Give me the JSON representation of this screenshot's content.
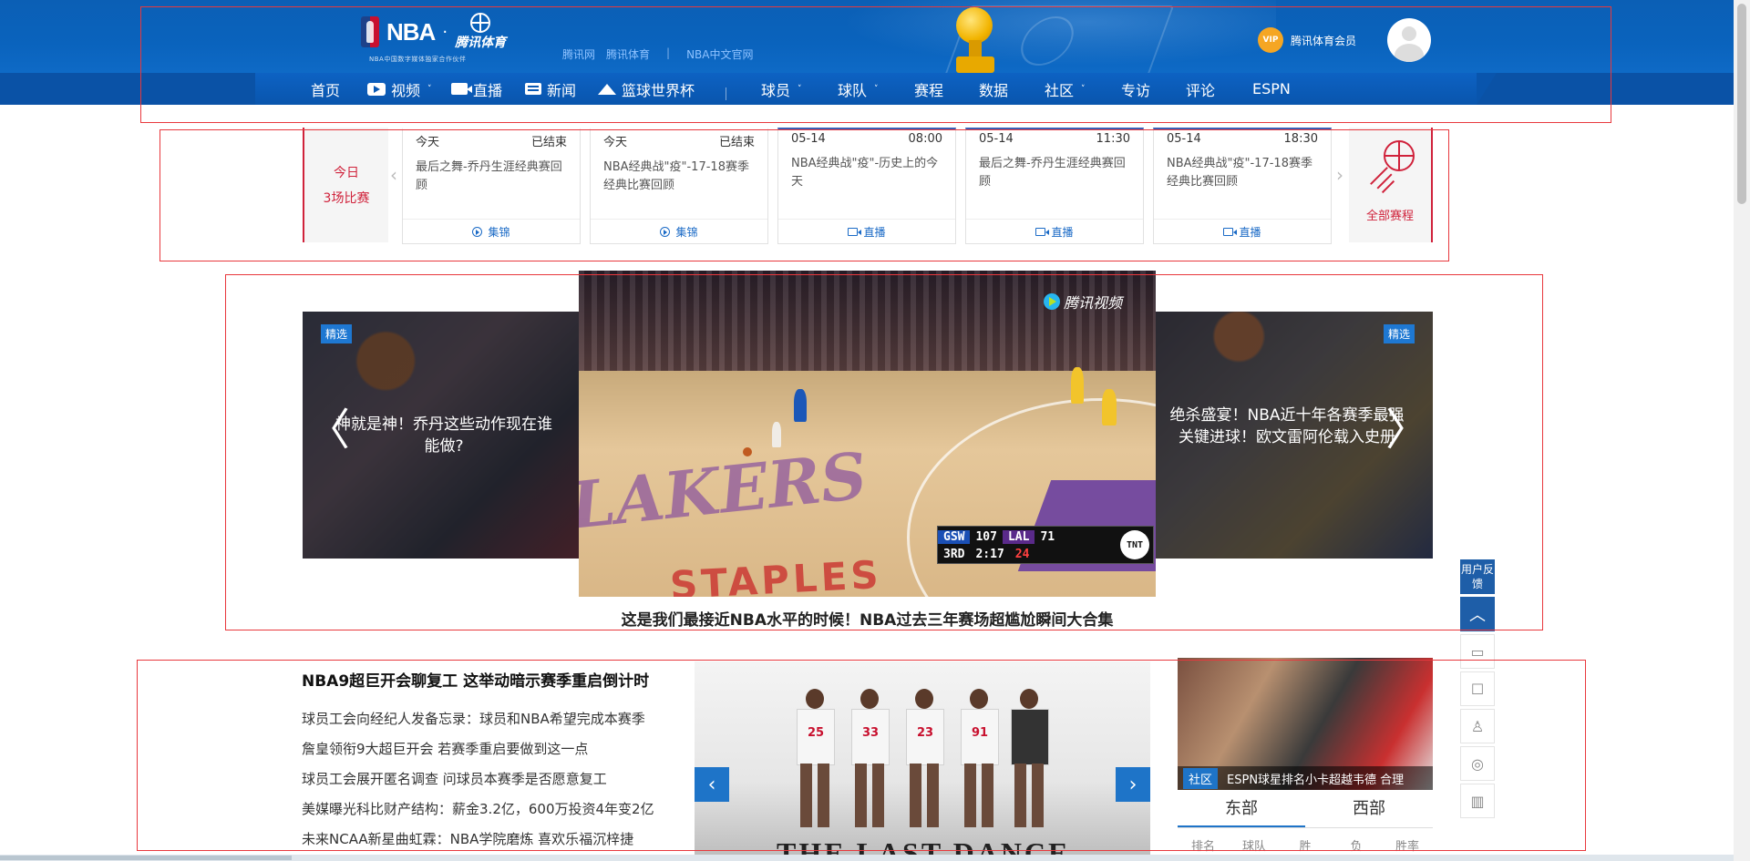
{
  "header": {
    "logo_nba": "NBA",
    "logo_dot": "·",
    "logo_tencent": "腾讯体育",
    "logo_sub": "NBA中国数字媒体独家合作伙伴",
    "top_links": [
      "腾讯网",
      "腾讯体育",
      "|",
      "NBA中文官网"
    ],
    "vip_badge": "VIP",
    "vip_label": "腾讯体育会员"
  },
  "nav": {
    "items": [
      {
        "label": "首页"
      },
      {
        "label": "视频",
        "icon": "video-icon",
        "caret": "˅"
      },
      {
        "label": "直播",
        "icon": "live-camera-icon"
      },
      {
        "label": "新闻",
        "icon": "news-icon"
      },
      {
        "label": "篮球世界杯",
        "icon": "crown-icon"
      },
      {
        "label": "球员",
        "caret": "˅"
      },
      {
        "label": "球队",
        "caret": "˅"
      },
      {
        "label": "赛程"
      },
      {
        "label": "数据"
      },
      {
        "label": "社区",
        "caret": "˅"
      },
      {
        "label": "专访"
      },
      {
        "label": "评论"
      },
      {
        "label": "ESPN"
      }
    ]
  },
  "schedule": {
    "today_label": "今日",
    "count_label": "3场比赛",
    "prev_arrow": "‹",
    "next_arrow": "›",
    "all_label": "全部赛程",
    "cards": [
      {
        "date": "今天",
        "status": "已结束",
        "title": "最后之舞-乔丹生涯经典赛回顾",
        "action": "集锦",
        "kind": "highlight"
      },
      {
        "date": "今天",
        "status": "已结束",
        "title": "NBA经典战\"疫\"-17-18赛季经典比赛回顾",
        "action": "集锦",
        "kind": "highlight"
      },
      {
        "date": "05-14",
        "status": "08:00",
        "title": "NBA经典战\"疫\"-历史上的今天",
        "action": "直播",
        "kind": "live"
      },
      {
        "date": "05-14",
        "status": "11:30",
        "title": "最后之舞-乔丹生涯经典赛回顾",
        "action": "直播",
        "kind": "live"
      },
      {
        "date": "05-14",
        "status": "18:30",
        "title": "NBA经典战\"疫\"-17-18赛季经典比赛回顾",
        "action": "直播",
        "kind": "live"
      }
    ]
  },
  "hero": {
    "left_badge": "精选",
    "left_caption": "神就是神！乔丹这些动作现在谁能做?",
    "right_badge": "精选",
    "right_caption": "绝杀盛宴！NBA近十年各赛季最强关键进球！欧文雷阿伦载入史册",
    "prev_arrow": "〈",
    "next_arrow": "〉",
    "tv_logo": "腾讯视频",
    "scorebug": {
      "team1": "GSW",
      "score1": "107",
      "team2": "LAL",
      "score2": "71",
      "period": "3RD",
      "clock": "2:17",
      "shot": "24",
      "network": "TNT"
    },
    "main_caption": "这是我们最接近NBA水平的时候！NBA过去三年赛场超尴尬瞬间大合集"
  },
  "news": {
    "headline": "NBA9超巨开会聊复工 这举动暗示赛季重启倒计时",
    "items": [
      "球员工会向经纪人发备忘录：球员和NBA希望完成本赛季",
      "詹皇领衔9大超巨开会 若赛季重启要做到这一点",
      "球员工会展开匿名调查 问球员本赛季是否愿意复工",
      "美媒曝光科比财产结构：薪金3.2亿，600万投资4年变2亿",
      "未来NCAA新星曲虹霖：NBA学院磨炼 喜欢乐福沉梓捷"
    ],
    "slide_title": "THE LAST DANCE",
    "slide_prev": "‹",
    "slide_next": "›",
    "jerseys": [
      "25",
      "33",
      "23",
      "91"
    ]
  },
  "sidebar": {
    "card_tag": "社区",
    "card_caption": "ESPN球星排名小卡超越韦德 合理",
    "tabs": [
      "东部",
      "西部"
    ],
    "columns": [
      "排名",
      "球队",
      "胜",
      "负",
      "胜率"
    ]
  },
  "toolbar": {
    "feedback": "用户反馈",
    "up": "︿",
    "icons": [
      "▭",
      "☐",
      "♙",
      "◎",
      "▥"
    ]
  }
}
